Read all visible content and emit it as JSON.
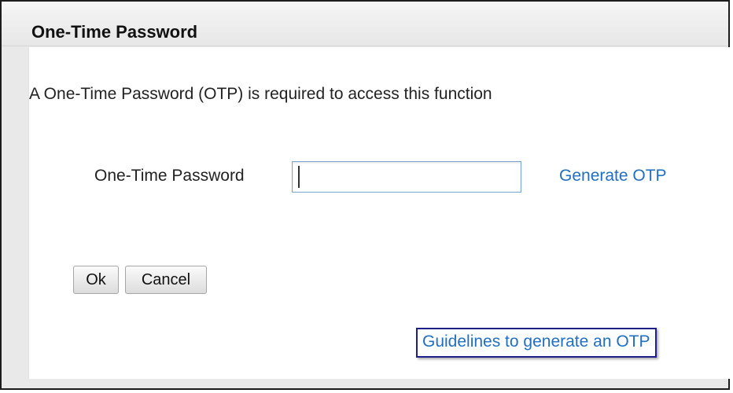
{
  "dialog": {
    "title": "One-Time Password",
    "message": "A One-Time Password (OTP) is required to access this function",
    "otp_field": {
      "label": "One-Time Password",
      "value": "",
      "placeholder": ""
    },
    "generate_link": "Generate OTP",
    "buttons": {
      "ok_label": "Ok",
      "cancel_label": "Cancel"
    },
    "guidelines_link": "Guidelines to generate an OTP"
  },
  "colors": {
    "link": "#1f6fc5",
    "highlight_border": "#1f1f8a",
    "input_border": "#7aa7d9"
  }
}
